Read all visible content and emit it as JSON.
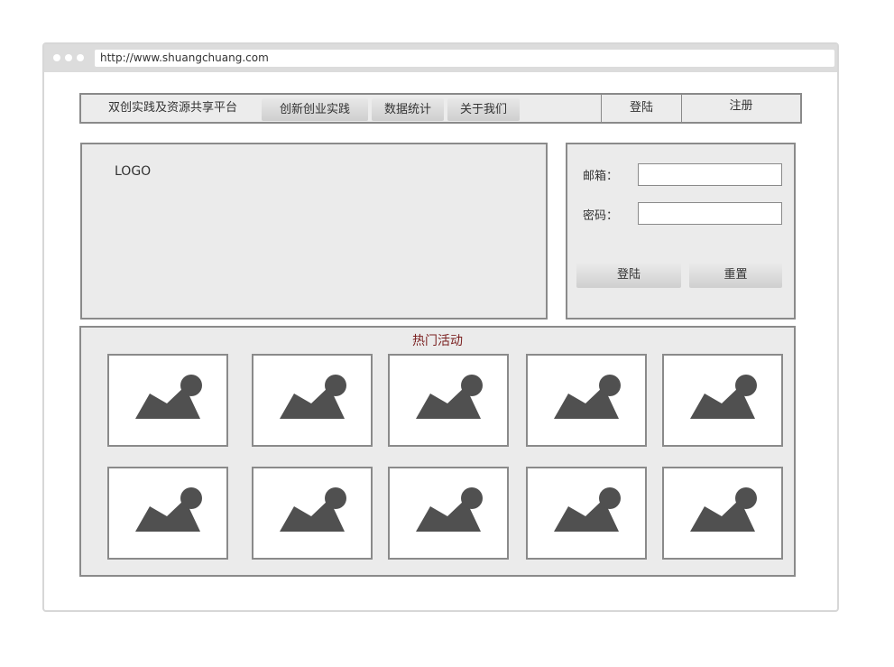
{
  "browser": {
    "url": "http://www.shuangchuang.com"
  },
  "nav": {
    "brand": "双创实践及资源共享平台",
    "items": [
      {
        "label": "创新创业实践"
      },
      {
        "label": "数据统计"
      },
      {
        "label": "关于我们"
      }
    ],
    "login_label": "登陆",
    "register_label": "注册"
  },
  "logo": {
    "text": "LOGO"
  },
  "login_form": {
    "email_label": "邮箱：",
    "email_value": "",
    "password_label": "密码：",
    "password_value": "",
    "submit_label": "登陆",
    "reset_label": "重置"
  },
  "hot": {
    "title": "热门活动",
    "title_color": "#7a1f1f",
    "thumbs": [
      {
        "icon": "image-placeholder-icon"
      },
      {
        "icon": "image-placeholder-icon"
      },
      {
        "icon": "image-placeholder-icon"
      },
      {
        "icon": "image-placeholder-icon"
      },
      {
        "icon": "image-placeholder-icon"
      },
      {
        "icon": "image-placeholder-icon"
      },
      {
        "icon": "image-placeholder-icon"
      },
      {
        "icon": "image-placeholder-icon"
      },
      {
        "icon": "image-placeholder-icon"
      },
      {
        "icon": "image-placeholder-icon"
      }
    ]
  },
  "colors": {
    "panel_bg": "#ebebeb",
    "border": "#8a8a8a",
    "icon_fill": "#505050"
  }
}
